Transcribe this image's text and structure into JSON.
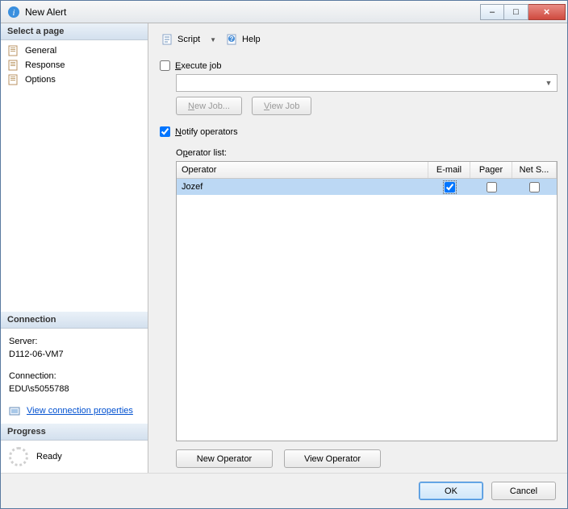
{
  "window": {
    "title": "New Alert"
  },
  "winbtns": {
    "min": "–",
    "max": "□",
    "close": "×"
  },
  "sidebar": {
    "select_page": "Select a page",
    "items": [
      {
        "label": "General"
      },
      {
        "label": "Response"
      },
      {
        "label": "Options"
      }
    ],
    "connection_header": "Connection",
    "server_label": "Server:",
    "server_value": "D112-06-VM7",
    "connection_label": "Connection:",
    "connection_value": "EDU\\s5055788",
    "view_conn_props": "View connection properties",
    "progress_header": "Progress",
    "progress_status": "Ready"
  },
  "toolbar": {
    "script": "Script",
    "help": "Help"
  },
  "form": {
    "execute_job": "Execute job",
    "new_job": "New Job...",
    "view_job": "View Job",
    "notify_operators": "Notify operators",
    "operator_list": "Operator list:",
    "new_operator": "New Operator",
    "view_operator": "View Operator"
  },
  "grid": {
    "cols": {
      "operator": "Operator",
      "email": "E-mail",
      "pager": "Pager",
      "netsend": "Net S..."
    },
    "rows": [
      {
        "operator": "Jozef",
        "email": true,
        "pager": false,
        "netsend": false
      }
    ]
  },
  "footer": {
    "ok": "OK",
    "cancel": "Cancel"
  }
}
